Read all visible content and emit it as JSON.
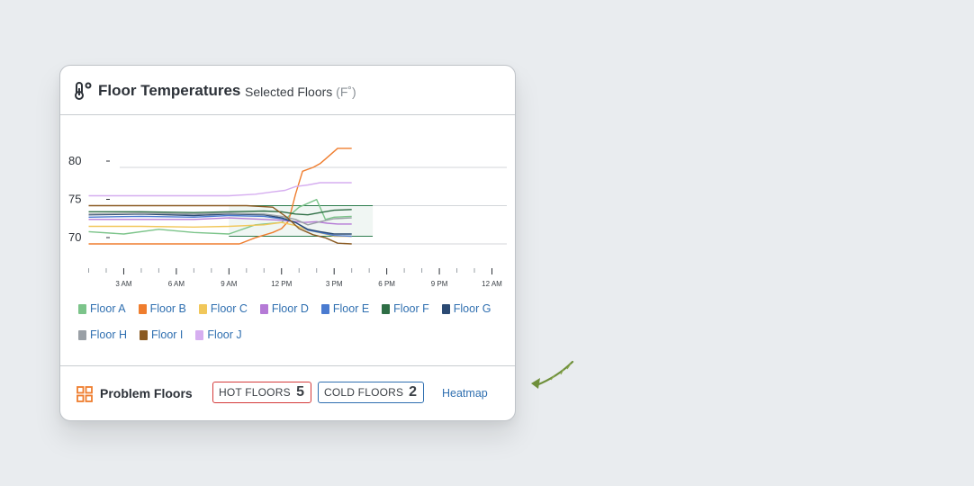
{
  "header": {
    "icon": "thermometer-degree-icon",
    "title": "Floor Temperatures",
    "subtitle": "Selected Floors",
    "unit": "(F˚)"
  },
  "chart_data": {
    "type": "line",
    "ytick_labels": [
      "80",
      "75",
      "70"
    ],
    "y_ticks": [
      80,
      75,
      70
    ],
    "ylim": [
      68,
      82
    ],
    "x_range_hours": [
      0,
      24
    ],
    "x_tick_labels": [
      "3 AM",
      "6 AM",
      "9 AM",
      "12 PM",
      "3 PM",
      "6 PM",
      "9 PM",
      "12 AM"
    ],
    "x_tick_hours": [
      2,
      5,
      8,
      11,
      14,
      17,
      20,
      23
    ],
    "grid": "horizontal",
    "target_band": {
      "low": 71,
      "high": 75,
      "start_hour": 8,
      "end_hour": 16.2,
      "color": "#2e7d4f"
    },
    "series": [
      {
        "name": "Floor A",
        "color": "#7cc48a",
        "hours": [
          0,
          2,
          4,
          6,
          8,
          9.5,
          11,
          12,
          13,
          13.5,
          14,
          15
        ],
        "values": [
          71.6,
          71.3,
          71.9,
          71.5,
          71.3,
          72.5,
          72.8,
          74.8,
          75.8,
          73.2,
          73.5,
          73.6
        ]
      },
      {
        "name": "Floor B",
        "color": "#ef7d2e",
        "hours": [
          0,
          2,
          4,
          6,
          8,
          8.6,
          9.5,
          10.5,
          11,
          11.4,
          11.8,
          12.2,
          12.8,
          13.2,
          13.7,
          14.2,
          15
        ],
        "values": [
          70,
          70,
          70,
          70,
          70,
          70,
          70.8,
          71.5,
          72,
          73,
          76.5,
          79.5,
          80,
          80.5,
          81.5,
          82.5,
          82.5
        ]
      },
      {
        "name": "Floor C",
        "color": "#f1c75a",
        "hours": [
          0,
          3,
          6,
          8,
          10,
          11,
          11.8,
          12.5,
          13.5,
          14,
          15
        ],
        "values": [
          72.3,
          72.3,
          72.2,
          72.3,
          72.5,
          72.8,
          72.4,
          71.8,
          71.3,
          71,
          71
        ]
      },
      {
        "name": "Floor D",
        "color": "#b57ad6",
        "hours": [
          0,
          3,
          6,
          8,
          10,
          11,
          11.8,
          12.3,
          13,
          13.6,
          14.2,
          15
        ],
        "values": [
          73.2,
          73.2,
          73.2,
          73.4,
          73.2,
          73.1,
          72.9,
          72.8,
          72.9,
          72.7,
          72.6,
          72.6
        ]
      },
      {
        "name": "Floor E",
        "color": "#4a7bd0",
        "hours": [
          0,
          3,
          6,
          8,
          10,
          11,
          11.8,
          12.5,
          13.2,
          14,
          15
        ],
        "values": [
          73.5,
          73.6,
          73.5,
          73.7,
          73.6,
          73.3,
          72.8,
          71.8,
          71.5,
          71.1,
          71
        ]
      },
      {
        "name": "Floor F",
        "color": "#2e6e45",
        "hours": [
          0,
          3,
          6,
          8,
          10,
          11,
          11.8,
          12.5,
          13.2,
          14,
          15
        ],
        "values": [
          74.2,
          74.2,
          74.1,
          74.2,
          74.3,
          74.2,
          73.9,
          73.8,
          74.1,
          74.4,
          74.5
        ]
      },
      {
        "name": "Floor G",
        "color": "#2b4a73",
        "hours": [
          0,
          3,
          6,
          8,
          10,
          11,
          11.8,
          12.5,
          13.2,
          14,
          15
        ],
        "values": [
          73.8,
          73.9,
          73.7,
          73.9,
          73.8,
          73.4,
          72.8,
          71.9,
          71.6,
          71.3,
          71.3
        ]
      },
      {
        "name": "Floor H",
        "color": "#9aa0a6",
        "hours": [
          0,
          3,
          6,
          8,
          10,
          11,
          11.8,
          12.5,
          13.2,
          14,
          15
        ],
        "values": [
          73.9,
          74,
          73.9,
          74,
          73.9,
          73.6,
          73.2,
          72.5,
          72.9,
          73.3,
          73.4
        ]
      },
      {
        "name": "Floor I",
        "color": "#8a5a22",
        "hours": [
          0,
          2,
          4,
          6,
          8,
          9,
          10.5,
          11.3,
          12,
          12.8,
          13.5,
          14.2,
          15
        ],
        "values": [
          75,
          75,
          75,
          75,
          75,
          75,
          74.8,
          73.5,
          72,
          71.2,
          70.8,
          70.1,
          70
        ]
      },
      {
        "name": "Floor J",
        "color": "#d6aef0",
        "hours": [
          0,
          3,
          6,
          8,
          9.5,
          10.5,
          11.2,
          11.8,
          12.5,
          13.2,
          14,
          15
        ],
        "values": [
          76.3,
          76.3,
          76.3,
          76.3,
          76.5,
          76.8,
          77,
          77.5,
          77.7,
          78,
          78,
          78
        ]
      }
    ]
  },
  "footer": {
    "icon": "grid-icon",
    "title": "Problem Floors",
    "hot_label": "HOT FLOORS",
    "hot_count": "5",
    "cold_label": "COLD FLOORS",
    "cold_count": "2",
    "heatmap_label": "Heatmap",
    "colors": {
      "hot": "#d43a3a",
      "cold": "#2f6fb0",
      "icon": "#ef7d2e"
    }
  },
  "decoration": {
    "icon": "hand-drawn-arrow-icon",
    "color": "#6e8f3a"
  }
}
